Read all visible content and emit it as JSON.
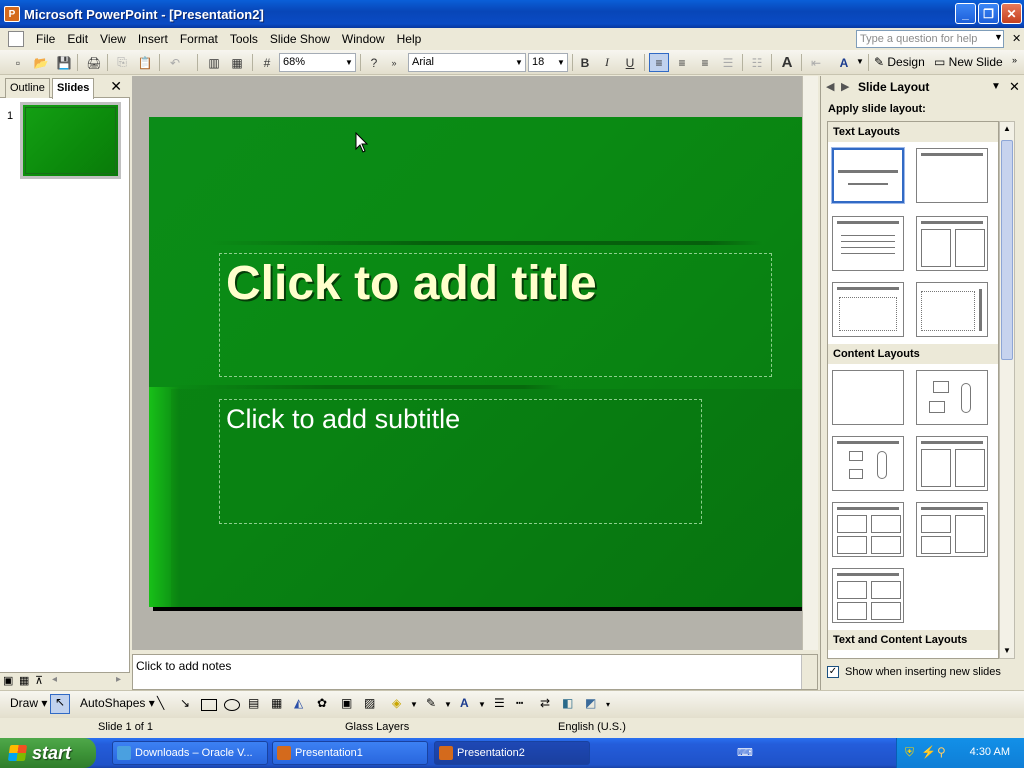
{
  "window": {
    "title": "Microsoft PowerPoint - [Presentation2]",
    "app_icon": "P"
  },
  "menu": [
    "File",
    "Edit",
    "View",
    "Insert",
    "Format",
    "Tools",
    "Slide Show",
    "Window",
    "Help"
  ],
  "help_box": {
    "placeholder": "Type a question for help"
  },
  "toolbar": {
    "zoom": "68%",
    "font": "Arial",
    "font_size": "18",
    "bold": "B",
    "italic": "I",
    "underline": "U",
    "design_label": "Design",
    "new_slide_label": "New Slide"
  },
  "left_pane": {
    "tab_outline": "Outline",
    "tab_slides": "Slides",
    "slide_number": "1"
  },
  "slide": {
    "title_placeholder": "Click to add title",
    "subtitle_placeholder": "Click to add subtitle"
  },
  "notes": {
    "placeholder": "Click to add notes"
  },
  "task_pane": {
    "title": "Slide Layout",
    "subtitle": "Apply slide layout:",
    "sections": [
      "Text Layouts",
      "Content Layouts",
      "Text and Content Layouts"
    ],
    "checkbox_label": "Show when inserting new slides",
    "checkbox_checked": "✓"
  },
  "draw_toolbar": {
    "draw_label": "Draw",
    "autoshapes_label": "AutoShapes"
  },
  "status": {
    "slide": "Slide 1 of 1",
    "design": "Glass Layers",
    "language": "English (U.S.)"
  },
  "taskbar": {
    "start": "start",
    "tasks": [
      "Downloads – Oracle V...",
      "Presentation1",
      "Presentation2"
    ],
    "clock": "4:30 AM"
  },
  "colors": {
    "slide_bg": "#0a8a13",
    "title_text": "#ffffcc",
    "accent": "#316ac5"
  }
}
